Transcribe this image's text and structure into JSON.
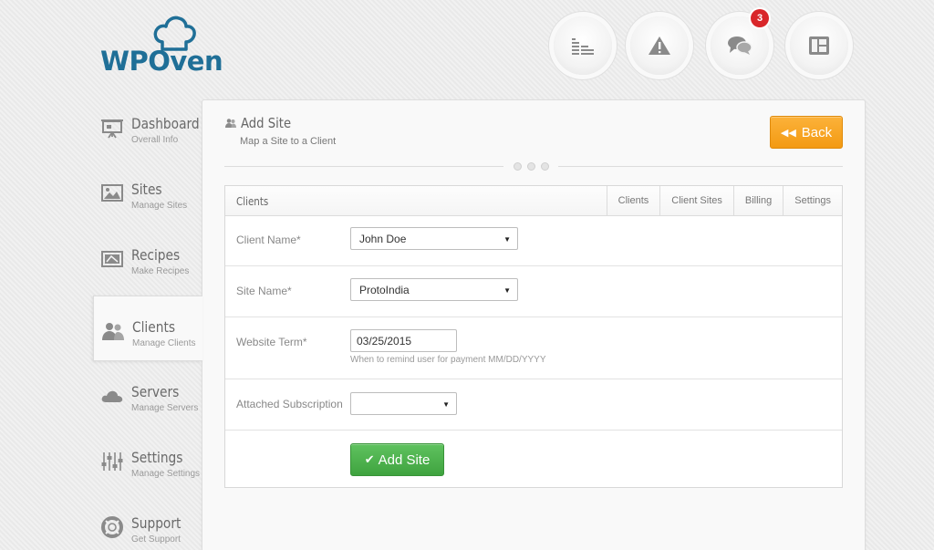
{
  "brand": {
    "name": "WPOven",
    "color": "#1f6f97"
  },
  "top_buttons": [
    {
      "icon": "coins-icon"
    },
    {
      "icon": "warning-icon"
    },
    {
      "icon": "chat-icon",
      "badge": "3"
    },
    {
      "icon": "layout-icon"
    }
  ],
  "sidebar": {
    "items": [
      {
        "title": "Dashboard",
        "sub": "Overall Info",
        "icon": "presentation-icon"
      },
      {
        "title": "Sites",
        "sub": "Manage Sites",
        "icon": "image-icon"
      },
      {
        "title": "Recipes",
        "sub": "Make Recipes",
        "icon": "recipes-icon"
      },
      {
        "title": "Clients",
        "sub": "Manage Clients",
        "icon": "users-icon",
        "active": true
      },
      {
        "title": "Servers",
        "sub": "Manage Servers",
        "icon": "cloud-icon"
      },
      {
        "title": "Settings",
        "sub": "Manage Settings",
        "icon": "sliders-icon"
      },
      {
        "title": "Support",
        "sub": "Get Support",
        "icon": "lifebuoy-icon"
      }
    ]
  },
  "page": {
    "title": "Add Site",
    "subtitle": "Map a Site to a Client",
    "back_label": "Back"
  },
  "card": {
    "title": "Clients",
    "tabs": [
      "Clients",
      "Client Sites",
      "Billing",
      "Settings"
    ]
  },
  "form": {
    "client_name_label": "Client Name*",
    "client_name_value": "John Doe",
    "site_name_label": "Site Name*",
    "site_name_value": "ProtoIndia",
    "website_term_label": "Website Term*",
    "website_term_value": "03/25/2015",
    "website_term_hint": "When to remind user for payment MM/DD/YYYY",
    "subscription_label": "Attached Subscription",
    "subscription_value": "",
    "submit_label": "Add Site"
  },
  "colors": {
    "accent_orange": "#f39a12",
    "accent_green": "#3fa33f",
    "badge_red": "#d9262a"
  }
}
